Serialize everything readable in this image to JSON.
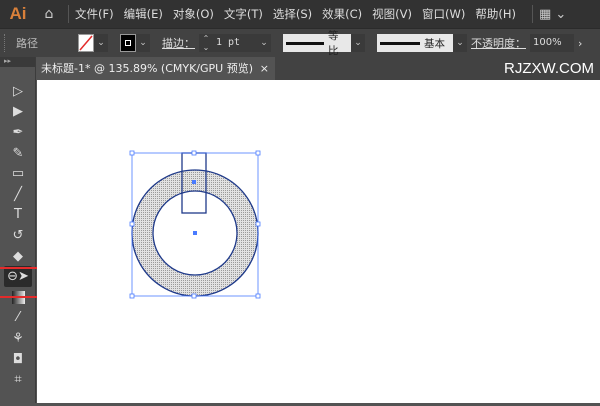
{
  "app": {
    "logo": "Ai"
  },
  "menu": [
    "文件(F)",
    "编辑(E)",
    "对象(O)",
    "文字(T)",
    "选择(S)",
    "效果(C)",
    "视图(V)",
    "窗口(W)",
    "帮助(H)"
  ],
  "control": {
    "object_type": "路径",
    "stroke_label": "描边：",
    "stroke_weight": "1 pt",
    "profile": "等比",
    "brush": "基本",
    "opacity_label": "不透明度：",
    "opacity": "100%"
  },
  "tab": {
    "title": "未标题-1* @ 135.89% (CMYK/GPU 预览)",
    "close": "×"
  },
  "watermark": "RJZXW.COM",
  "tools": [
    "direct-selection",
    "selection",
    "pen",
    "curvature",
    "rectangle",
    "paintbrush",
    "type",
    "rotate",
    "eraser",
    "shape-builder",
    "gradient",
    "eyedropper",
    "puppet-warp",
    "symbol-sprayer",
    "artboard"
  ],
  "colors": {
    "accent": "#e32b2b",
    "selection": "#4a7bff",
    "path": "#1f3a8a"
  }
}
